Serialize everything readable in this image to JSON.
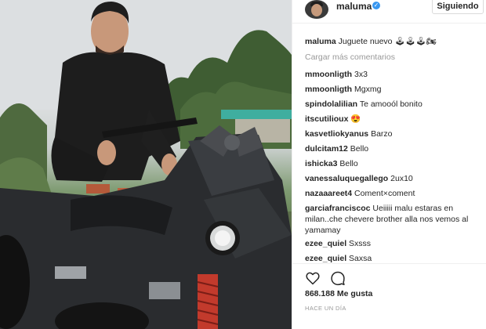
{
  "post": {
    "username": "maluma",
    "follow_label": "Siguiendo",
    "verified": true,
    "photo_alt": "man crouching on black quad bike with bow"
  },
  "comments": [
    {
      "user": "maluma",
      "text": "Juguete nuevo 🕹🕹🕹🏍"
    },
    {
      "user": "",
      "text": "Cargar más comentarios",
      "kind": "load-more"
    },
    {
      "user": "mmoonligth",
      "text": "3x3"
    },
    {
      "user": "mmoonligth",
      "text": "Mgxmg"
    },
    {
      "user": "spindolalilian",
      "text": "Te amooól bonito"
    },
    {
      "user": "itscutilioux",
      "text": "😍"
    },
    {
      "user": "kasvetliokyanus",
      "text": "Barzo"
    },
    {
      "user": "dulcitam12",
      "text": "Bello"
    },
    {
      "user": "ishicka3",
      "text": "Bello"
    },
    {
      "user": "vanessaluquegallego",
      "text": "2ux10"
    },
    {
      "user": "nazaaareet4",
      "text": "Coment×coment"
    },
    {
      "user": "garciafranciscoc",
      "text": "Ueiiiii malu estaras en milan..che chevere brother alla nos vemos al yamamay"
    },
    {
      "user": "ezee_quiel",
      "text": "Sxsss"
    },
    {
      "user": "ezee_quiel",
      "text": "Saxsa"
    }
  ],
  "actions": {
    "like_icon": "heart-icon",
    "comment_icon": "comment-bubble-icon",
    "likes": "868.188 Me gusta",
    "time": "HACE UN DÍA"
  },
  "colors": {
    "verified": "#3897f0",
    "muted": "#999999",
    "text": "#262626",
    "border": "#efefef"
  }
}
